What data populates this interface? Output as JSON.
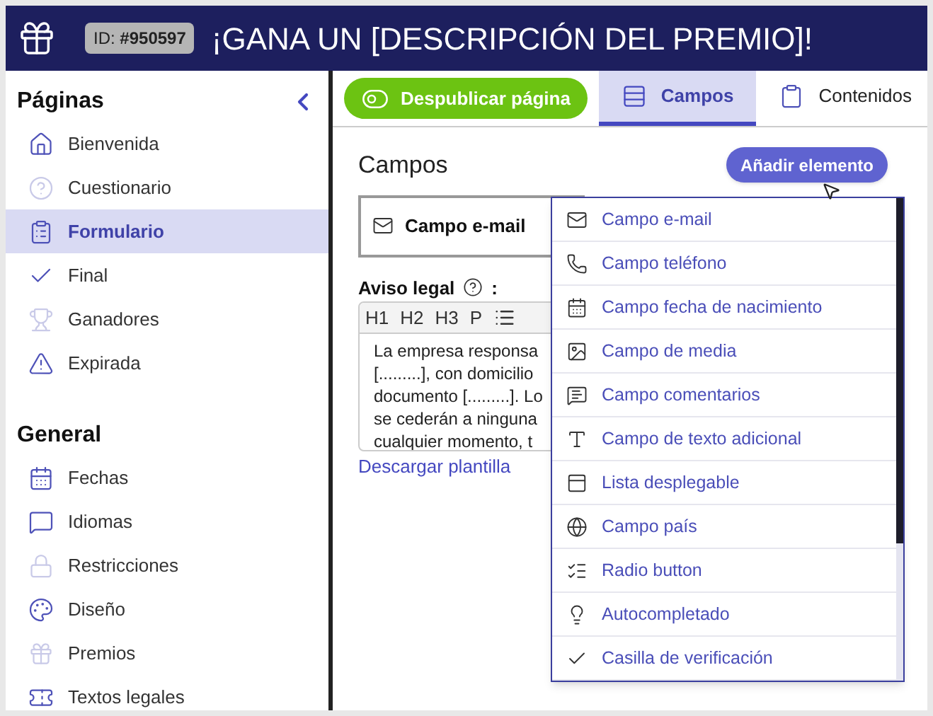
{
  "header": {
    "id_badge": "ID: **#950597**",
    "title": "¡GANA UN [DESCRIPCIÓN DEL PREMIO]!"
  },
  "sidebar": {
    "sections": [
      {
        "title": "Páginas",
        "items": [
          {
            "label": "Bienvenida",
            "selected": false,
            "faint": false
          },
          {
            "label": "Cuestionario",
            "selected": false,
            "faint": true
          },
          {
            "label": "Formulario",
            "selected": true,
            "faint": false
          },
          {
            "label": "Final",
            "selected": false,
            "faint": false
          },
          {
            "label": "Ganadores",
            "selected": false,
            "faint": true
          },
          {
            "label": "Expirada",
            "selected": false,
            "faint": false
          }
        ]
      },
      {
        "title": "General",
        "items": [
          {
            "label": "Fechas",
            "selected": false,
            "faint": false
          },
          {
            "label": "Idiomas",
            "selected": false,
            "faint": false
          },
          {
            "label": "Restricciones",
            "selected": false,
            "faint": true
          },
          {
            "label": "Diseño",
            "selected": false,
            "faint": false
          },
          {
            "label": "Premios",
            "selected": false,
            "faint": true
          },
          {
            "label": "Textos legales",
            "selected": false,
            "faint": false
          }
        ]
      }
    ]
  },
  "toolbar": {
    "publish_button": "Despublicar página",
    "tabs": [
      {
        "label": "Campos",
        "selected": true
      },
      {
        "label": "Contenidos",
        "selected": false
      }
    ]
  },
  "content": {
    "title": "Campos",
    "add_button": "Añadir elemento",
    "field_card": "Campo e-mail",
    "legal_label": "Aviso legal",
    "legal_label_colon": ":",
    "editor_tools": [
      "H1",
      "H2",
      "H3",
      "P"
    ],
    "legal_lines": [
      "La empresa responsa",
      "[.........], con domicilio",
      "documento [.........]. Lo",
      "se cederán a ninguna",
      "cualquier momento, t"
    ],
    "download_link": "Descargar plantilla"
  },
  "dropdown": [
    {
      "label": "Campo e-mail"
    },
    {
      "label": "Campo teléfono"
    },
    {
      "label": "Campo fecha de nacimiento"
    },
    {
      "label": "Campo de media"
    },
    {
      "label": "Campo comentarios"
    },
    {
      "label": "Campo de texto adicional"
    },
    {
      "label": "Lista desplegable"
    },
    {
      "label": "Campo país"
    },
    {
      "label": "Radio button"
    },
    {
      "label": "Autocompletado"
    },
    {
      "label": "Casilla de verificación"
    }
  ]
}
